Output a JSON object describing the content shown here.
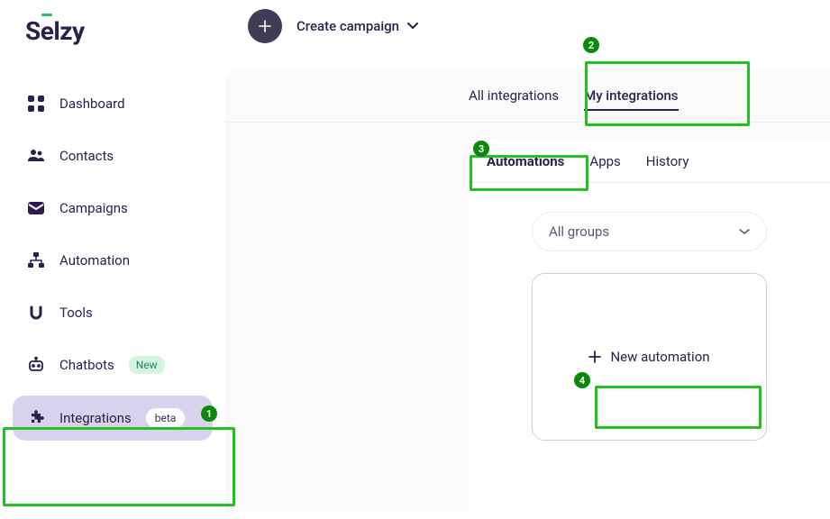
{
  "sidebar": {
    "logo": "Sēlzy",
    "items": [
      {
        "label": "Dashboard"
      },
      {
        "label": "Contacts"
      },
      {
        "label": "Campaigns"
      },
      {
        "label": "Automation"
      },
      {
        "label": "Tools"
      },
      {
        "label": "Chatbots",
        "badge": "New"
      },
      {
        "label": "Integrations",
        "badge": "beta",
        "active": true
      }
    ]
  },
  "topbar": {
    "create_label": "Create campaign"
  },
  "primary_tabs": {
    "all": "All integrations",
    "my": "My integrations"
  },
  "sub_tabs": {
    "automations": "Automations",
    "apps": "Apps",
    "history": "History"
  },
  "filter": {
    "label": "All groups"
  },
  "card": {
    "label": "New automation"
  },
  "callouts": [
    "1",
    "2",
    "3",
    "4"
  ]
}
